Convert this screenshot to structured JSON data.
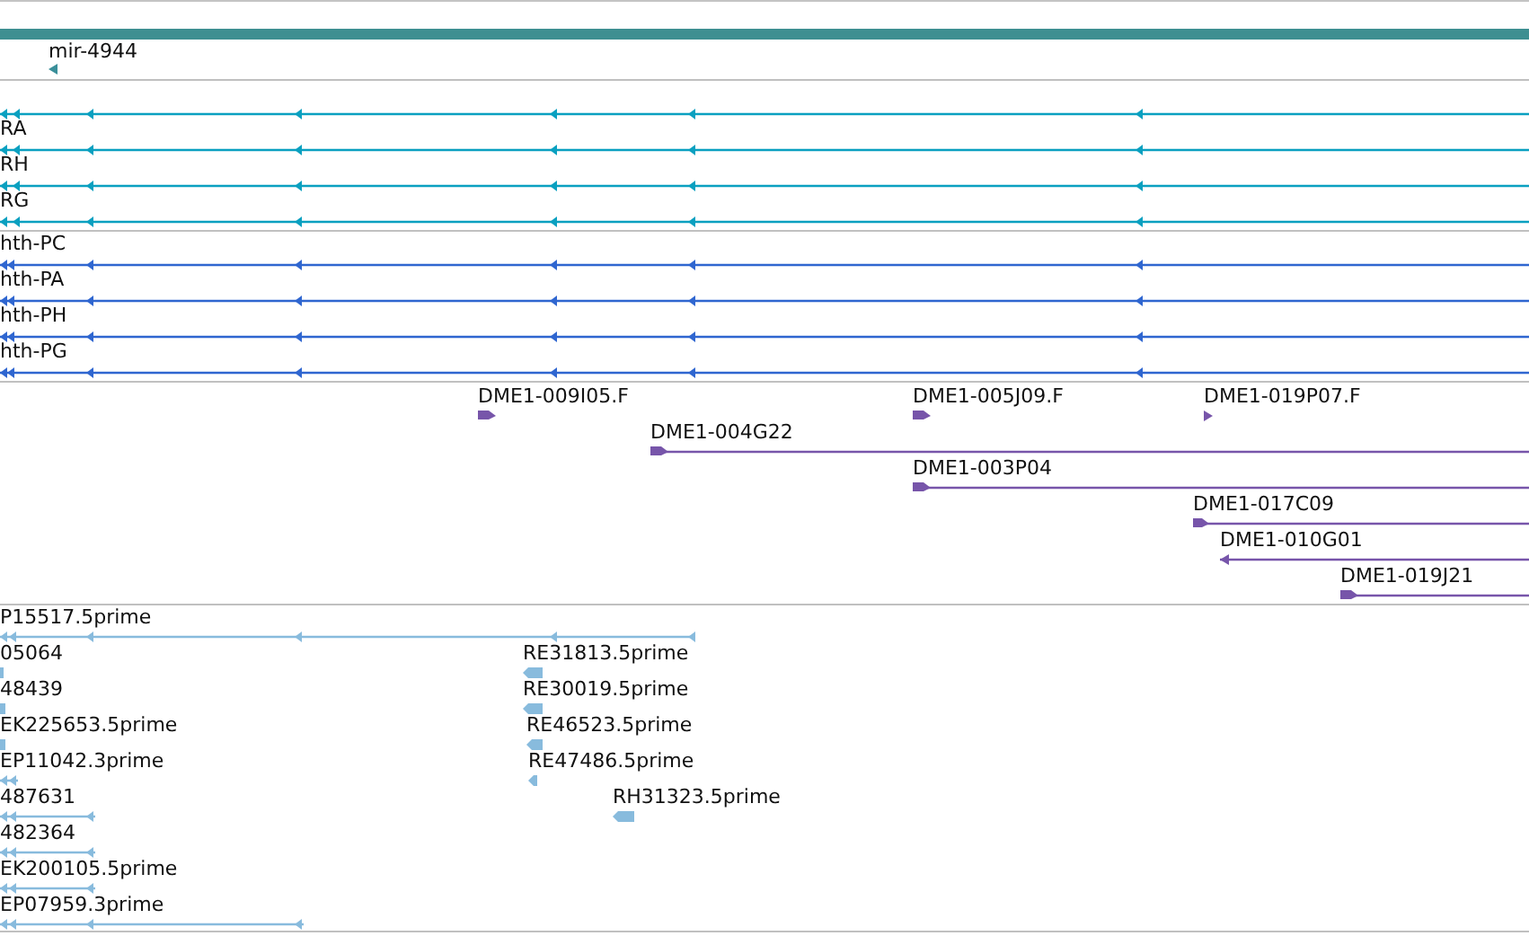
{
  "tracks": [
    {
      "features": [
        {
          "kind": "mirna",
          "label": "mir-4944"
        }
      ]
    },
    {
      "features": [
        {
          "kind": "transcript"
        },
        {
          "kind": "transcript",
          "label": "RA"
        },
        {
          "kind": "transcript",
          "label": "RH"
        },
        {
          "kind": "transcript",
          "label": "RG"
        }
      ]
    },
    {
      "features": [
        {
          "kind": "polypeptide",
          "label": "hth-PC"
        },
        {
          "kind": "polypeptide",
          "label": "hth-PA"
        },
        {
          "kind": "polypeptide",
          "label": "hth-PH"
        },
        {
          "kind": "polypeptide",
          "label": "hth-PG"
        }
      ]
    },
    {
      "features": [
        {
          "kind": "clone",
          "label": "DME1-009I05.F"
        },
        {
          "kind": "clone",
          "label": "DME1-005J09.F"
        },
        {
          "kind": "clone",
          "label": "DME1-019P07.F"
        },
        {
          "kind": "clone",
          "label": "DME1-004G22"
        },
        {
          "kind": "clone",
          "label": "DME1-003P04"
        },
        {
          "kind": "clone",
          "label": "DME1-017C09"
        },
        {
          "kind": "clone",
          "label": "DME1-010G01"
        },
        {
          "kind": "clone",
          "label": "DME1-019J21"
        }
      ]
    },
    {
      "features": [
        {
          "kind": "est",
          "label": "P15517.5prime"
        },
        {
          "kind": "est",
          "label": "05064"
        },
        {
          "kind": "est",
          "label": "RE31813.5prime"
        },
        {
          "kind": "est",
          "label": "48439"
        },
        {
          "kind": "est",
          "label": "RE30019.5prime"
        },
        {
          "kind": "est",
          "label": "EK225653.5prime"
        },
        {
          "kind": "est",
          "label": "RE46523.5prime"
        },
        {
          "kind": "est",
          "label": "EP11042.3prime"
        },
        {
          "kind": "est",
          "label": "RE47486.5prime"
        },
        {
          "kind": "est",
          "label": "487631"
        },
        {
          "kind": "est",
          "label": "RH31323.5prime"
        },
        {
          "kind": "est",
          "label": "482364"
        },
        {
          "kind": "est",
          "label": "EK200105.5prime"
        },
        {
          "kind": "est",
          "label": "EP07959.3prime"
        }
      ]
    }
  ]
}
